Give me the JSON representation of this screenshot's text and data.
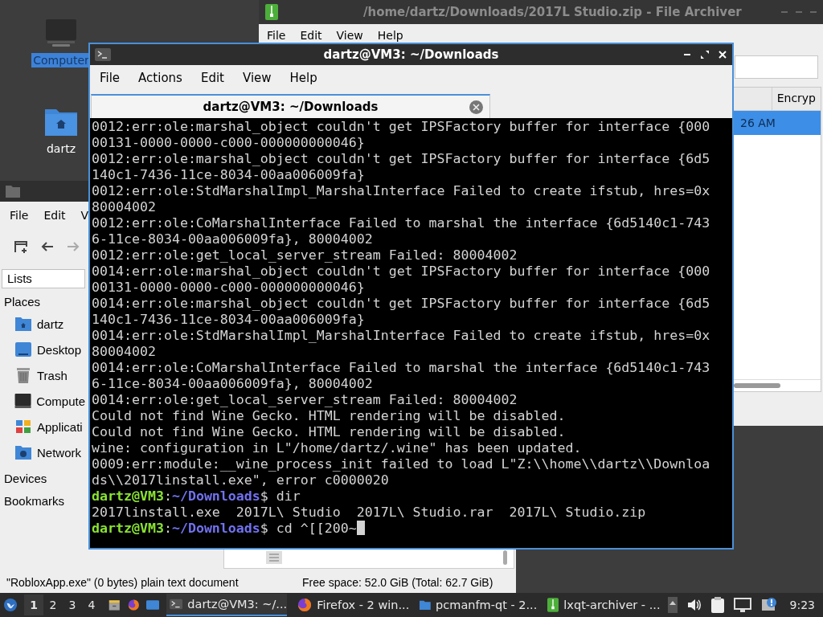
{
  "desktop": {
    "icons": [
      {
        "label": "Computer",
        "kind": "computer",
        "selected": true
      },
      {
        "label": "dartz",
        "kind": "home-folder",
        "selected": false
      }
    ]
  },
  "archiver_window": {
    "title": "/home/dartz/Downloads/2017L Studio.zip - File Archiver",
    "menu": [
      "File",
      "Edit",
      "View",
      "Help"
    ],
    "table": {
      "columns": [
        "Encryp"
      ],
      "rows": [
        {
          "cells": [
            "26 AM"
          ],
          "selected": true
        }
      ]
    }
  },
  "file_manager_window": {
    "menu": [
      "File",
      "Edit",
      "V"
    ],
    "view_selector": "Lists",
    "sidebar": {
      "sections": [
        {
          "title": "Places",
          "items": [
            {
              "label": "dartz",
              "kind": "home"
            },
            {
              "label": "Desktop",
              "kind": "desktop"
            },
            {
              "label": "Trash",
              "kind": "trash"
            },
            {
              "label": "Compute",
              "kind": "computer"
            },
            {
              "label": "Applicati",
              "kind": "applications"
            },
            {
              "label": "Network",
              "kind": "network"
            }
          ]
        },
        {
          "title": "Devices"
        },
        {
          "title": "Bookmarks"
        }
      ]
    },
    "status_bar": {
      "selection": "\"RobloxApp.exe\" (0 bytes) plain text document",
      "free_space": "Free space: 52.0 GiB (Total: 62.7 GiB)"
    }
  },
  "terminal_window": {
    "title": "dartz@VM3: ~/Downloads",
    "menu": [
      "File",
      "Actions",
      "Edit",
      "View",
      "Help"
    ],
    "tabs": [
      {
        "label": "dartz@VM3: ~/Downloads",
        "selected": true
      }
    ],
    "lines": [
      {
        "kind": "output",
        "text": "0012:err:ole:marshal_object couldn't get IPSFactory buffer for interface {000"
      },
      {
        "kind": "output",
        "text": "00131-0000-0000-c000-000000000046}"
      },
      {
        "kind": "output",
        "text": "0012:err:ole:marshal_object couldn't get IPSFactory buffer for interface {6d5"
      },
      {
        "kind": "output",
        "text": "140c1-7436-11ce-8034-00aa006009fa}"
      },
      {
        "kind": "output",
        "text": "0012:err:ole:StdMarshalImpl_MarshalInterface Failed to create ifstub, hres=0x"
      },
      {
        "kind": "output",
        "text": "80004002"
      },
      {
        "kind": "output",
        "text": "0012:err:ole:CoMarshalInterface Failed to marshal the interface {6d5140c1-743"
      },
      {
        "kind": "output",
        "text": "6-11ce-8034-00aa006009fa}, 80004002"
      },
      {
        "kind": "output",
        "text": "0012:err:ole:get_local_server_stream Failed: 80004002"
      },
      {
        "kind": "output",
        "text": "0014:err:ole:marshal_object couldn't get IPSFactory buffer for interface {000"
      },
      {
        "kind": "output",
        "text": "00131-0000-0000-c000-000000000046}"
      },
      {
        "kind": "output",
        "text": "0014:err:ole:marshal_object couldn't get IPSFactory buffer for interface {6d5"
      },
      {
        "kind": "output",
        "text": "140c1-7436-11ce-8034-00aa006009fa}"
      },
      {
        "kind": "output",
        "text": "0014:err:ole:StdMarshalImpl_MarshalInterface Failed to create ifstub, hres=0x"
      },
      {
        "kind": "output",
        "text": "80004002"
      },
      {
        "kind": "output",
        "text": "0014:err:ole:CoMarshalInterface Failed to marshal the interface {6d5140c1-743"
      },
      {
        "kind": "output",
        "text": "6-11ce-8034-00aa006009fa}, 80004002"
      },
      {
        "kind": "output",
        "text": "0014:err:ole:get_local_server_stream Failed: 80004002"
      },
      {
        "kind": "output",
        "text": "Could not find Wine Gecko. HTML rendering will be disabled."
      },
      {
        "kind": "output",
        "text": "Could not find Wine Gecko. HTML rendering will be disabled."
      },
      {
        "kind": "output",
        "text": "wine: configuration in L\"/home/dartz/.wine\" has been updated."
      },
      {
        "kind": "output",
        "text": "0009:err:module:__wine_process_init failed to load L\"Z:\\\\home\\\\dartz\\\\Downloa"
      },
      {
        "kind": "output",
        "text": "ds\\\\2017linstall.exe\", error c0000020"
      },
      {
        "kind": "prompt",
        "user": "dartz@VM3",
        "separator": ":",
        "path": "~/Downloads",
        "tail": "$ dir",
        "cursor": false
      },
      {
        "kind": "output",
        "text": "2017linstall.exe  2017L\\ Studio  2017L\\ Studio.rar  2017L\\ Studio.zip"
      },
      {
        "kind": "prompt",
        "user": "dartz@VM3",
        "separator": ":",
        "path": "~/Downloads",
        "tail": "$ cd ^[[200~",
        "cursor": true
      }
    ]
  },
  "taskbar": {
    "workspaces": [
      {
        "label": "1",
        "selected": true
      },
      {
        "label": "2",
        "selected": false
      },
      {
        "label": "3",
        "selected": false
      },
      {
        "label": "4",
        "selected": false
      }
    ],
    "tasks": [
      {
        "label": "dartz@VM3: ~/...",
        "kind": "terminal",
        "selected": true
      },
      {
        "label": "Firefox - 2 win...",
        "kind": "browser",
        "selected": false
      },
      {
        "label": "pcmanfm-qt - 2...",
        "kind": "folder",
        "selected": false
      },
      {
        "label": "lxqt-archiver - ...",
        "kind": "archive",
        "selected": false
      }
    ],
    "clock": "9:23"
  }
}
